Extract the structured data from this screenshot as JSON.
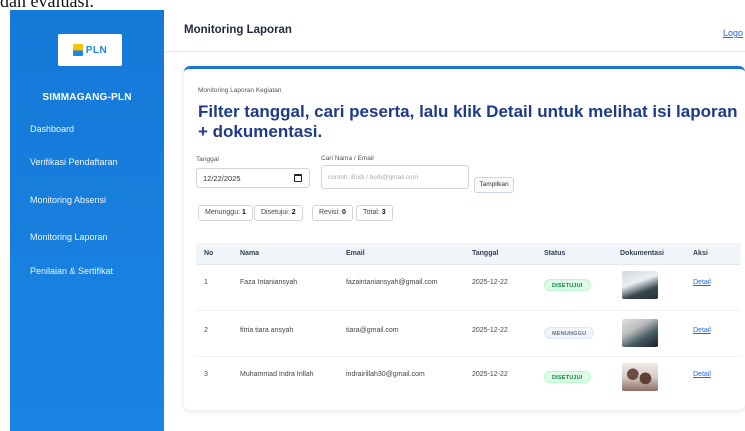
{
  "top_fragment": "dan evaluasi.",
  "sidebar": {
    "logo_text": "PLN",
    "app_name": "SIMMAGANG-PLN",
    "items": [
      {
        "label": "Dashboard"
      },
      {
        "label": "Verifikasi Pendaftaran"
      },
      {
        "label": "Monitoring Absensi"
      },
      {
        "label": "Monitoring Laporan"
      },
      {
        "label": "Penilaian & Sertifikat"
      }
    ]
  },
  "header": {
    "title": "Monitoring Laporan",
    "logout": "Logo"
  },
  "card": {
    "label": "Monitoring Laporan Kegiatan",
    "heading_pre": "Filter tanggal, cari peserta, lalu klik ",
    "heading_bold": "Detail",
    "heading_post": " untuk melihat isi laporan + dokumentasi."
  },
  "filters": {
    "date_label": "Tanggal",
    "date_value": "12/22/2025",
    "search_label": "Cari Nama / Email",
    "search_placeholder": "contoh: Budi / budi@gmail.com",
    "show_button": "Tampilkan"
  },
  "counters": [
    {
      "label": "Menunggu:",
      "value": "1"
    },
    {
      "label": "Disetujui:",
      "value": "2"
    },
    {
      "label": "Revisi:",
      "value": "0"
    },
    {
      "label": "Total:",
      "value": "3"
    }
  ],
  "table": {
    "headers": [
      "No",
      "Nama",
      "Email",
      "Tanggal",
      "Status",
      "Dokumentasi",
      "Aksi"
    ],
    "rows": [
      {
        "no": "1",
        "nama": "Faza Intaniansyah",
        "email": "fazaintaniansyah@gmail.com",
        "tanggal": "2025-12-22",
        "status": "DISETUJUI",
        "status_kind": "approved",
        "aksi": "Detail"
      },
      {
        "no": "2",
        "nama": "fitria tiara ansyah",
        "email": "tiara@gmail.com",
        "tanggal": "2025-12-22",
        "status": "MENUNGGU",
        "status_kind": "waiting",
        "aksi": "Detail"
      },
      {
        "no": "3",
        "nama": "Muhammad Indra Irillah",
        "email": "indrairillah30@gmail.com",
        "tanggal": "2025-12-22",
        "status": "DISETUJUI",
        "status_kind": "approved",
        "aksi": "Detail"
      }
    ]
  },
  "colors": {
    "sidebar": "#1579d8",
    "accent": "#1976d2",
    "heading": "#1e3a8a",
    "approved": "#15803d"
  }
}
